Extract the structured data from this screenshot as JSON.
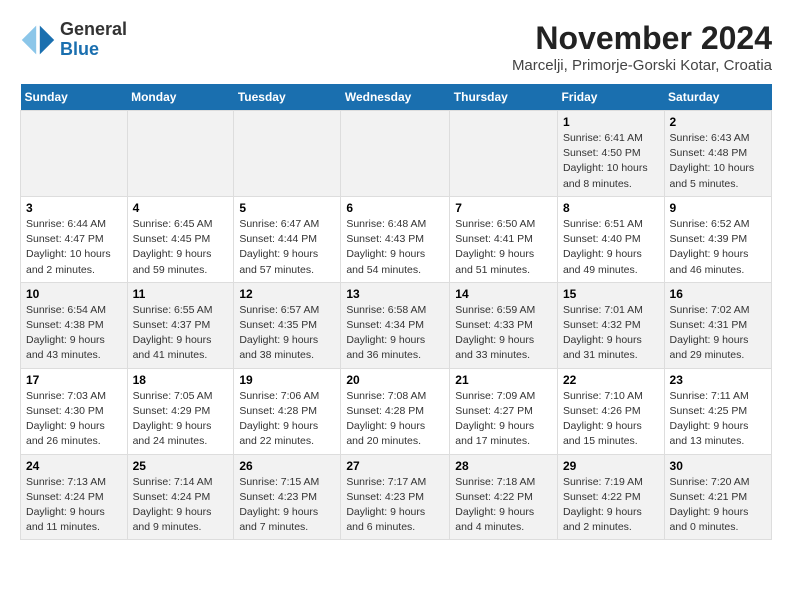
{
  "header": {
    "logo_general": "General",
    "logo_blue": "Blue",
    "month_title": "November 2024",
    "location": "Marcelji, Primorje-Gorski Kotar, Croatia"
  },
  "days_of_week": [
    "Sunday",
    "Monday",
    "Tuesday",
    "Wednesday",
    "Thursday",
    "Friday",
    "Saturday"
  ],
  "weeks": [
    [
      {
        "day": "",
        "info": ""
      },
      {
        "day": "",
        "info": ""
      },
      {
        "day": "",
        "info": ""
      },
      {
        "day": "",
        "info": ""
      },
      {
        "day": "",
        "info": ""
      },
      {
        "day": "1",
        "info": "Sunrise: 6:41 AM\nSunset: 4:50 PM\nDaylight: 10 hours and 8 minutes."
      },
      {
        "day": "2",
        "info": "Sunrise: 6:43 AM\nSunset: 4:48 PM\nDaylight: 10 hours and 5 minutes."
      }
    ],
    [
      {
        "day": "3",
        "info": "Sunrise: 6:44 AM\nSunset: 4:47 PM\nDaylight: 10 hours and 2 minutes."
      },
      {
        "day": "4",
        "info": "Sunrise: 6:45 AM\nSunset: 4:45 PM\nDaylight: 9 hours and 59 minutes."
      },
      {
        "day": "5",
        "info": "Sunrise: 6:47 AM\nSunset: 4:44 PM\nDaylight: 9 hours and 57 minutes."
      },
      {
        "day": "6",
        "info": "Sunrise: 6:48 AM\nSunset: 4:43 PM\nDaylight: 9 hours and 54 minutes."
      },
      {
        "day": "7",
        "info": "Sunrise: 6:50 AM\nSunset: 4:41 PM\nDaylight: 9 hours and 51 minutes."
      },
      {
        "day": "8",
        "info": "Sunrise: 6:51 AM\nSunset: 4:40 PM\nDaylight: 9 hours and 49 minutes."
      },
      {
        "day": "9",
        "info": "Sunrise: 6:52 AM\nSunset: 4:39 PM\nDaylight: 9 hours and 46 minutes."
      }
    ],
    [
      {
        "day": "10",
        "info": "Sunrise: 6:54 AM\nSunset: 4:38 PM\nDaylight: 9 hours and 43 minutes."
      },
      {
        "day": "11",
        "info": "Sunrise: 6:55 AM\nSunset: 4:37 PM\nDaylight: 9 hours and 41 minutes."
      },
      {
        "day": "12",
        "info": "Sunrise: 6:57 AM\nSunset: 4:35 PM\nDaylight: 9 hours and 38 minutes."
      },
      {
        "day": "13",
        "info": "Sunrise: 6:58 AM\nSunset: 4:34 PM\nDaylight: 9 hours and 36 minutes."
      },
      {
        "day": "14",
        "info": "Sunrise: 6:59 AM\nSunset: 4:33 PM\nDaylight: 9 hours and 33 minutes."
      },
      {
        "day": "15",
        "info": "Sunrise: 7:01 AM\nSunset: 4:32 PM\nDaylight: 9 hours and 31 minutes."
      },
      {
        "day": "16",
        "info": "Sunrise: 7:02 AM\nSunset: 4:31 PM\nDaylight: 9 hours and 29 minutes."
      }
    ],
    [
      {
        "day": "17",
        "info": "Sunrise: 7:03 AM\nSunset: 4:30 PM\nDaylight: 9 hours and 26 minutes."
      },
      {
        "day": "18",
        "info": "Sunrise: 7:05 AM\nSunset: 4:29 PM\nDaylight: 9 hours and 24 minutes."
      },
      {
        "day": "19",
        "info": "Sunrise: 7:06 AM\nSunset: 4:28 PM\nDaylight: 9 hours and 22 minutes."
      },
      {
        "day": "20",
        "info": "Sunrise: 7:08 AM\nSunset: 4:28 PM\nDaylight: 9 hours and 20 minutes."
      },
      {
        "day": "21",
        "info": "Sunrise: 7:09 AM\nSunset: 4:27 PM\nDaylight: 9 hours and 17 minutes."
      },
      {
        "day": "22",
        "info": "Sunrise: 7:10 AM\nSunset: 4:26 PM\nDaylight: 9 hours and 15 minutes."
      },
      {
        "day": "23",
        "info": "Sunrise: 7:11 AM\nSunset: 4:25 PM\nDaylight: 9 hours and 13 minutes."
      }
    ],
    [
      {
        "day": "24",
        "info": "Sunrise: 7:13 AM\nSunset: 4:24 PM\nDaylight: 9 hours and 11 minutes."
      },
      {
        "day": "25",
        "info": "Sunrise: 7:14 AM\nSunset: 4:24 PM\nDaylight: 9 hours and 9 minutes."
      },
      {
        "day": "26",
        "info": "Sunrise: 7:15 AM\nSunset: 4:23 PM\nDaylight: 9 hours and 7 minutes."
      },
      {
        "day": "27",
        "info": "Sunrise: 7:17 AM\nSunset: 4:23 PM\nDaylight: 9 hours and 6 minutes."
      },
      {
        "day": "28",
        "info": "Sunrise: 7:18 AM\nSunset: 4:22 PM\nDaylight: 9 hours and 4 minutes."
      },
      {
        "day": "29",
        "info": "Sunrise: 7:19 AM\nSunset: 4:22 PM\nDaylight: 9 hours and 2 minutes."
      },
      {
        "day": "30",
        "info": "Sunrise: 7:20 AM\nSunset: 4:21 PM\nDaylight: 9 hours and 0 minutes."
      }
    ]
  ]
}
